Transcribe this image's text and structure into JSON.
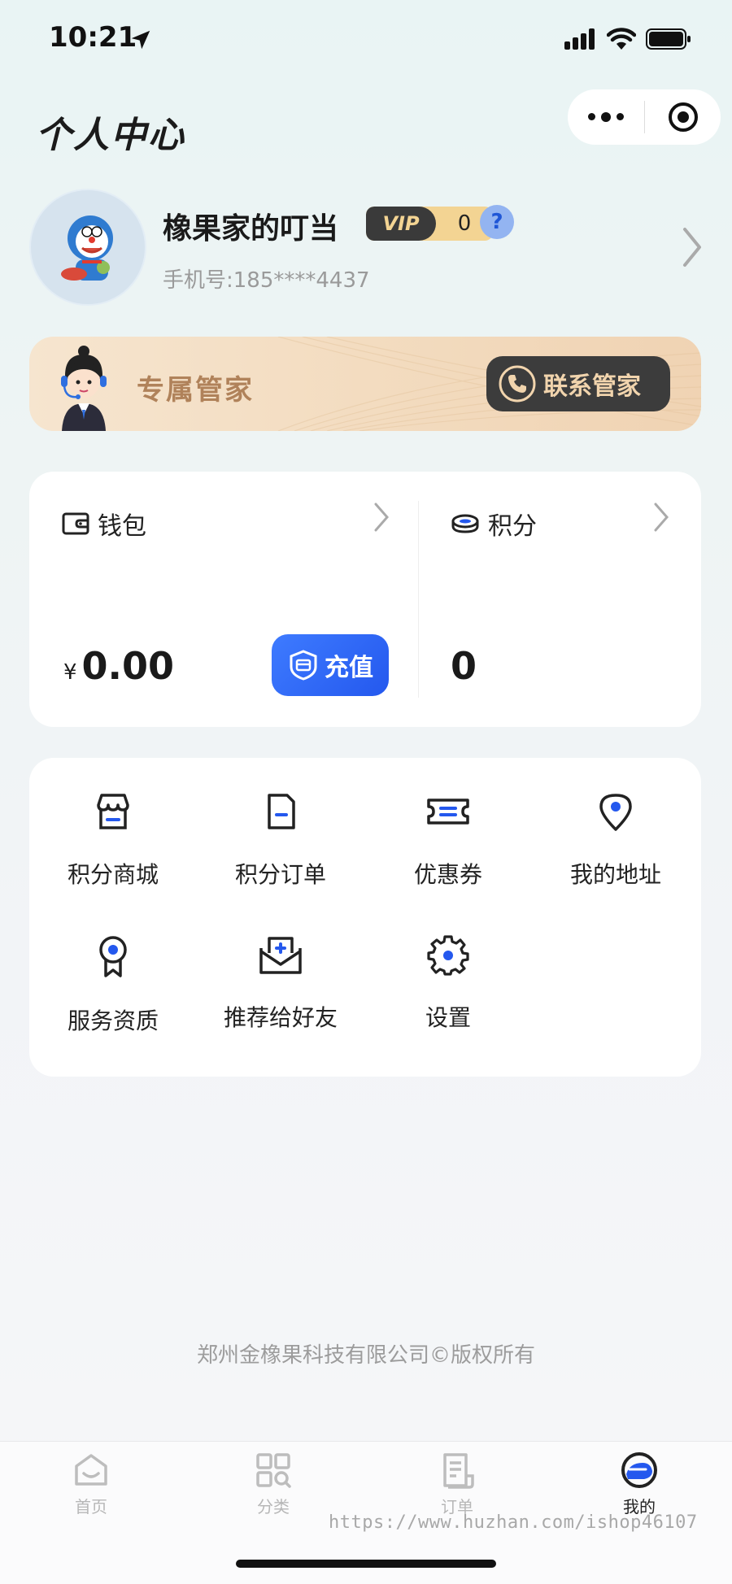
{
  "status_bar": {
    "time": "10:21"
  },
  "page": {
    "title": "个人中心"
  },
  "profile": {
    "username": "橡果家的叮当",
    "vip_label": "VIP",
    "vip_level": "0",
    "help_glyph": "?",
    "phone": "手机号:185****4437"
  },
  "butler": {
    "label": "专属管家",
    "contact_button": "联系管家"
  },
  "wallet": {
    "title": "钱包",
    "currency": "¥",
    "balance": "0.00",
    "recharge_button": "充值"
  },
  "points": {
    "title": "积分",
    "value": "0"
  },
  "services": [
    {
      "label": "积分商城",
      "icon": "store-icon"
    },
    {
      "label": "积分订单",
      "icon": "order-doc-icon"
    },
    {
      "label": "优惠券",
      "icon": "coupon-icon"
    },
    {
      "label": "我的地址",
      "icon": "location-pin-icon"
    },
    {
      "label": "服务资质",
      "icon": "award-ribbon-icon"
    },
    {
      "label": "推荐给好友",
      "icon": "envelope-share-icon"
    },
    {
      "label": "设置",
      "icon": "gear-icon"
    }
  ],
  "footer": {
    "copyright": "郑州金橡果科技有限公司©版权所有"
  },
  "tabbar": {
    "items": [
      {
        "label": "首页",
        "icon": "home-icon",
        "active": false
      },
      {
        "label": "分类",
        "icon": "category-grid-icon",
        "active": false
      },
      {
        "label": "订单",
        "icon": "order-list-icon",
        "active": false
      },
      {
        "label": "我的",
        "icon": "profile-icon",
        "active": true
      }
    ]
  },
  "watermark": "https://www.huzhan.com/ishop46107",
  "colors": {
    "accent_blue": "#2458ee",
    "butler_gold": "#b0825a",
    "vip_gold": "#f3d493",
    "dark_button": "#3c3c3c"
  }
}
